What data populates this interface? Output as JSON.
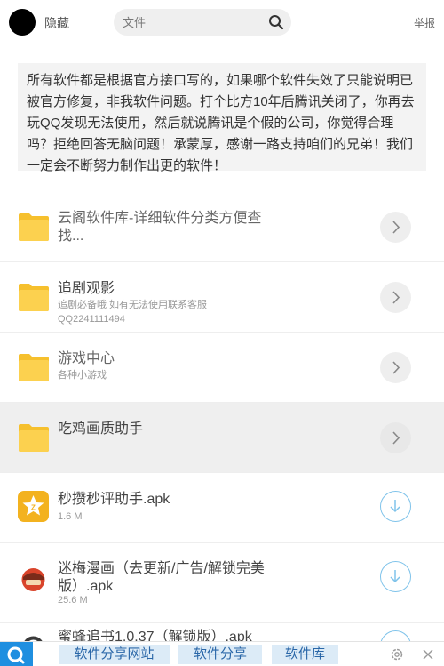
{
  "header": {
    "hide_label": "隐藏",
    "search_placeholder": "文件",
    "report_label": "举报"
  },
  "notice": {
    "text": "所有软件都是根据官方接口写的，如果哪个软件失效了只能说明已被官方修复，非我软件问题。打个比方10年后腾讯关闭了，你再去玩QQ发现无法使用，然后就说腾讯是个假的公司，你觉得合理吗？拒绝回答无脑问题！承蒙厚，感谢一路支持咱们的兄弟！我们一定会不断努力制作出更的软件！"
  },
  "folders": [
    {
      "title": "云阁软件库-详细软件分类方便查找...",
      "subtitle": ""
    },
    {
      "title": "追剧观影",
      "subtitle": "追剧必备哦 如有无法使用联系客服",
      "subtitle2": "QQ2241111494"
    },
    {
      "title": "游戏中心",
      "subtitle": "各种小游戏"
    },
    {
      "title": "吃鸡画质助手",
      "subtitle": ""
    }
  ],
  "files": [
    {
      "title": "秒攒秒评助手.apk",
      "size": "1.6 M"
    },
    {
      "title": "迷梅漫画（去更新/广告/解锁完美版）.apk",
      "size": "25.6 M"
    },
    {
      "title": "蜜蜂追书1.0.37（解锁版）.apk",
      "size": ""
    }
  ],
  "bottom_bar": {
    "tabs": [
      "软件分享网站",
      "软件分享",
      "软件库"
    ]
  },
  "colors": {
    "folder": "#fcd14f",
    "download_ring": "#7fc3ea",
    "bottom_logo": "#1f8fe0",
    "tab_bg": "#dcebf7"
  }
}
